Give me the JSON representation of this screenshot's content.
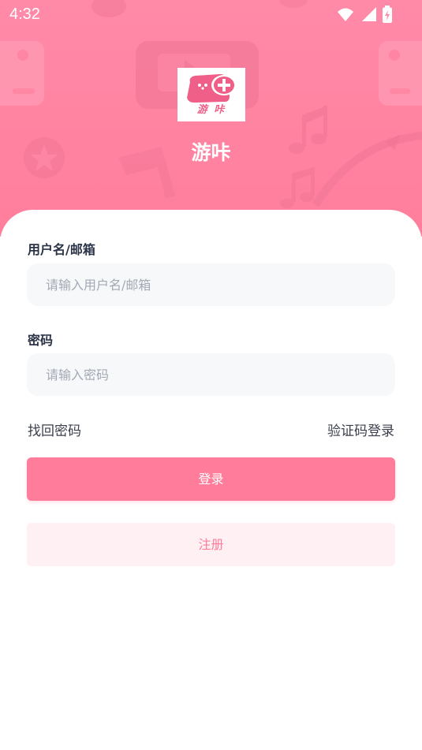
{
  "status_bar": {
    "time": "4:32",
    "icons": [
      "wifi-icon",
      "cellular-signal-icon",
      "battery-charging-icon"
    ]
  },
  "app": {
    "logo_text": "游 咔",
    "name": "游咔"
  },
  "form": {
    "username_label": "用户名/邮箱",
    "username_placeholder": "请输入用户名/邮箱",
    "username_value": "",
    "password_label": "密码",
    "password_placeholder": "请输入密码",
    "password_value": ""
  },
  "links": {
    "recover_password": "找回密码",
    "sms_login": "验证码登录"
  },
  "buttons": {
    "login": "登录",
    "register": "注册"
  },
  "colors": {
    "brand_pink": "#ff7c9b",
    "header_pink": "#ff8aa8",
    "register_bg": "#fff0f3",
    "input_bg": "#f7f8fa",
    "label_text": "#2b3347",
    "placeholder_text": "#a3a8b3"
  }
}
